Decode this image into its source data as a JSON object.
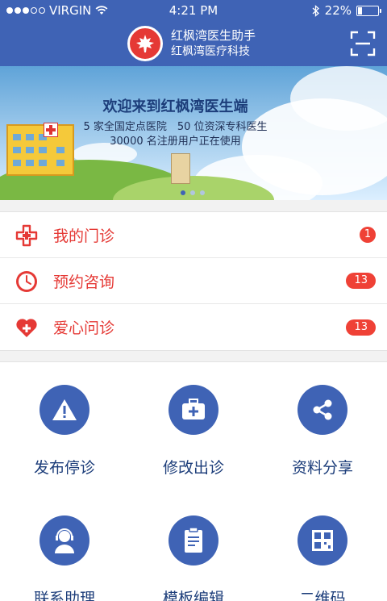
{
  "status": {
    "carrier": "VIRGIN",
    "time": "4:21 PM",
    "battery": "22%",
    "battery_level": 0.22
  },
  "header": {
    "title": "红枫湾医生助手",
    "subtitle": "红枫湾医疗科技",
    "scan_icon": "scan-qr-icon"
  },
  "banner": {
    "title": "欢迎来到红枫湾医生端",
    "line1": "5 家全国定点医院　50 位资深专科医生",
    "line2": "30000 名注册用户正在使用",
    "pages": 3,
    "active_page": 1
  },
  "menu": [
    {
      "label": "我的门诊",
      "badge": "1",
      "icon": "medical-cross-icon"
    },
    {
      "label": "预约咨询",
      "badge": "13",
      "icon": "clock-icon"
    },
    {
      "label": "爱心问诊",
      "badge": "13",
      "icon": "heart-plus-icon"
    }
  ],
  "grid": [
    {
      "label": "发布停诊",
      "icon": "warning-icon"
    },
    {
      "label": "修改出诊",
      "icon": "medical-kit-icon"
    },
    {
      "label": "资料分享",
      "icon": "share-icon"
    },
    {
      "label": "联系助理",
      "icon": "assistant-icon"
    },
    {
      "label": "模板编辑",
      "icon": "template-icon"
    },
    {
      "label": "二维码",
      "icon": "qr-code-icon"
    }
  ],
  "colors": {
    "primary": "#3f63b5",
    "accent": "#e53935",
    "badge": "#ef4136"
  }
}
